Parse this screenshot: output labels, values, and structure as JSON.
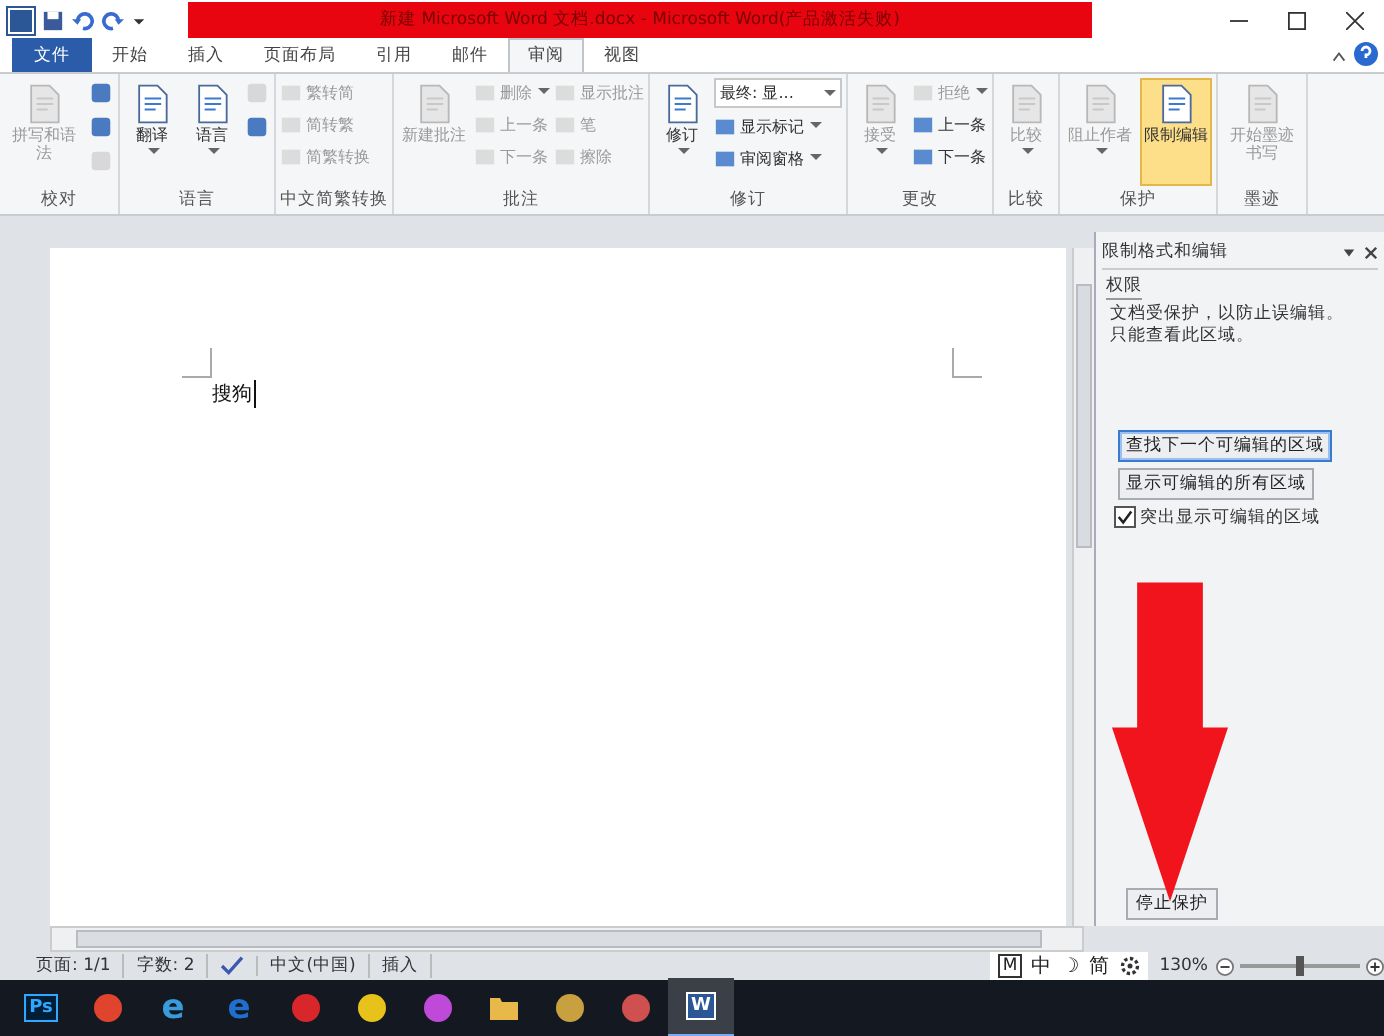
{
  "window": {
    "title": "新建 Microsoft Word 文档.docx - Microsoft Word(产品激活失败)"
  },
  "tabs": [
    {
      "label": "文件",
      "kind": "file",
      "selected": false
    },
    {
      "label": "开始",
      "kind": "tab",
      "selected": false
    },
    {
      "label": "插入",
      "kind": "tab",
      "selected": false
    },
    {
      "label": "页面布局",
      "kind": "tab",
      "selected": false
    },
    {
      "label": "引用",
      "kind": "tab",
      "selected": false
    },
    {
      "label": "邮件",
      "kind": "tab",
      "selected": false
    },
    {
      "label": "审阅",
      "kind": "tab",
      "selected": true
    },
    {
      "label": "视图",
      "kind": "tab",
      "selected": false
    }
  ],
  "ribbon": {
    "groups": [
      {
        "label": "校对",
        "columns": [
          [
            {
              "kind": "large",
              "label": "拼写和语法",
              "disabled": true,
              "menu": false,
              "on": false
            }
          ],
          [
            {
              "kind": "icon",
              "disabled": false,
              "on": false
            },
            {
              "kind": "icon",
              "disabled": false,
              "on": false
            },
            {
              "kind": "icon",
              "disabled": true,
              "on": false
            }
          ]
        ]
      },
      {
        "label": "语言",
        "columns": [
          [
            {
              "kind": "large",
              "label": "翻译",
              "disabled": false,
              "menu": true,
              "on": false
            }
          ],
          [
            {
              "kind": "large",
              "label": "语言",
              "disabled": false,
              "menu": true,
              "on": false
            }
          ],
          [
            {
              "kind": "icon",
              "disabled": true,
              "on": false
            },
            {
              "kind": "icon",
              "disabled": false,
              "on": false
            }
          ]
        ]
      },
      {
        "label": "中文简繁转换",
        "columns": [
          [
            {
              "kind": "small",
              "label": "繁转简",
              "disabled": true,
              "menu": false,
              "on": false
            },
            {
              "kind": "small",
              "label": "简转繁",
              "disabled": true,
              "menu": false,
              "on": false
            },
            {
              "kind": "small",
              "label": "简繁转换",
              "disabled": true,
              "menu": false,
              "on": false
            }
          ]
        ]
      },
      {
        "label": "批注",
        "columns": [
          [
            {
              "kind": "large",
              "label": "新建批注",
              "disabled": true,
              "menu": false,
              "on": false
            }
          ],
          [
            {
              "kind": "small",
              "label": "删除",
              "disabled": true,
              "menu": true,
              "on": false
            },
            {
              "kind": "small",
              "label": "上一条",
              "disabled": true,
              "menu": false,
              "on": false
            },
            {
              "kind": "small",
              "label": "下一条",
              "disabled": true,
              "menu": false,
              "on": false
            }
          ],
          [
            {
              "kind": "small",
              "label": "显示批注",
              "disabled": true,
              "menu": false,
              "on": false
            },
            {
              "kind": "small",
              "label": "笔",
              "disabled": true,
              "menu": false,
              "on": false
            },
            {
              "kind": "small",
              "label": "擦除",
              "disabled": true,
              "menu": false,
              "on": false
            }
          ]
        ]
      },
      {
        "label": "修订",
        "columns": [
          [
            {
              "kind": "large",
              "label": "修订",
              "disabled": false,
              "menu": true,
              "on": false
            }
          ],
          [
            {
              "kind": "select",
              "label": "最终: 显...",
              "disabled": false,
              "menu": true,
              "on": false
            },
            {
              "kind": "small",
              "label": "显示标记",
              "disabled": false,
              "menu": true,
              "on": false
            },
            {
              "kind": "small",
              "label": "审阅窗格",
              "disabled": false,
              "menu": true,
              "on": false
            }
          ]
        ]
      },
      {
        "label": "更改",
        "columns": [
          [
            {
              "kind": "large",
              "label": "接受",
              "disabled": true,
              "menu": true,
              "on": false
            }
          ],
          [
            {
              "kind": "small",
              "label": "拒绝",
              "disabled": true,
              "menu": true,
              "on": false
            },
            {
              "kind": "small",
              "label": "上一条",
              "disabled": false,
              "menu": false,
              "on": false
            },
            {
              "kind": "small",
              "label": "下一条",
              "disabled": false,
              "menu": false,
              "on": false
            }
          ]
        ]
      },
      {
        "label": "比较",
        "columns": [
          [
            {
              "kind": "large",
              "label": "比较",
              "disabled": true,
              "menu": true,
              "on": false
            }
          ]
        ]
      },
      {
        "label": "保护",
        "columns": [
          [
            {
              "kind": "large",
              "label": "阻止作者",
              "disabled": true,
              "menu": true,
              "on": false
            }
          ],
          [
            {
              "kind": "large",
              "label": "限制编辑",
              "disabled": false,
              "menu": false,
              "on": true
            }
          ]
        ]
      },
      {
        "label": "墨迹",
        "columns": [
          [
            {
              "kind": "large",
              "label": "开始墨迹书写",
              "disabled": true,
              "menu": false,
              "on": false
            }
          ]
        ]
      }
    ]
  },
  "document": {
    "text": "搜狗"
  },
  "pane": {
    "title": "限制格式和编辑",
    "section": "权限",
    "message": "文档受保护，以防止误编辑。只能查看此区域。",
    "buttons": [
      {
        "label": "查找下一个可编辑的区域",
        "focused": true
      },
      {
        "label": "显示可编辑的所有区域",
        "focused": false
      }
    ],
    "checkbox": {
      "label": "突出显示可编辑的区域",
      "checked": true
    },
    "stop_button": "停止保护"
  },
  "status_bar": {
    "items": [
      {
        "kind": "text",
        "label": "页面: 1/1"
      },
      {
        "kind": "text",
        "label": "字数: 2"
      },
      {
        "kind": "proofing"
      },
      {
        "kind": "text",
        "label": "中文(中国)"
      },
      {
        "kind": "text",
        "label": "插入"
      }
    ],
    "ime": [
      "M",
      "中",
      "☽",
      "简"
    ],
    "zoom": {
      "label": "130%",
      "level": 0.5
    }
  },
  "taskbar": {
    "items": [
      {
        "kind": "tile",
        "label": "Ps",
        "selected": false
      },
      {
        "kind": "round",
        "color": "#e0442f",
        "selected": false
      },
      {
        "kind": "letter",
        "label": "e",
        "color": "#3a9bdc",
        "selected": false
      },
      {
        "kind": "letter",
        "label": "e",
        "color": "#1f6fd0",
        "selected": false
      },
      {
        "kind": "round",
        "color": "#d9262a",
        "selected": false
      },
      {
        "kind": "round",
        "color": "#e6c21a",
        "selected": false
      },
      {
        "kind": "round",
        "color": "#c04ad8",
        "selected": false
      },
      {
        "kind": "folder",
        "color": "#e8b84a",
        "selected": false
      },
      {
        "kind": "round",
        "color": "#c8a040",
        "selected": false
      },
      {
        "kind": "round",
        "color": "#d05050",
        "selected": false
      },
      {
        "kind": "tile",
        "label": "W",
        "selected": true
      }
    ]
  }
}
